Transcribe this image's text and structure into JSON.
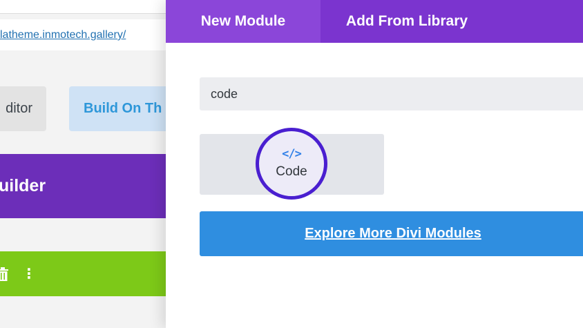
{
  "background_page": {
    "url_text": "latheme.inmotech.gallery/",
    "editor_button": "ditor",
    "build_button": "Build On Th",
    "builder_banner": "uilder",
    "toolbar_icons": [
      "trash-icon",
      "more-dots-icon"
    ]
  },
  "modal": {
    "tabs": [
      {
        "label": "New Module"
      },
      {
        "label": "Add From Library"
      }
    ],
    "search": {
      "value": "code"
    },
    "module": {
      "icon": "code-brackets-icon",
      "label": "Code"
    },
    "explore_label": "Explore More Divi Modules"
  },
  "colors": {
    "purple_tabs": "#7b34cf",
    "active_tab": "#8b46d9",
    "explore_blue": "#2f8ee0",
    "highlight_ring": "#4a1fd0",
    "green_bar": "#7dc918"
  }
}
